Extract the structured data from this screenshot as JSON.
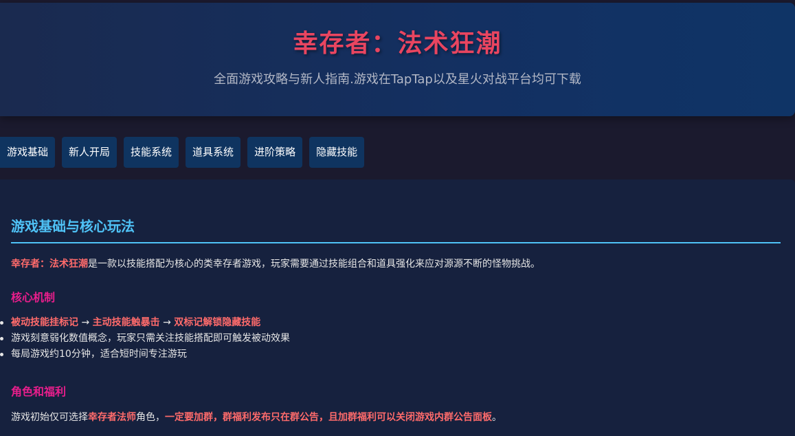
{
  "header": {
    "title": "幸存者：法术狂潮",
    "subtitle": "全面游戏攻略与新人指南.游戏在TapTap以及星火对战平台均可下载"
  },
  "nav": {
    "items": [
      {
        "label": "游戏基础"
      },
      {
        "label": "新人开局"
      },
      {
        "label": "技能系统"
      },
      {
        "label": "道具系统"
      },
      {
        "label": "进阶策略"
      },
      {
        "label": "隐藏技能"
      }
    ]
  },
  "content": {
    "section_title": "游戏基础与核心玩法",
    "intro": {
      "highlight": "幸存者：法术狂潮",
      "text": "是一款以技能搭配为核心的类幸存者游戏，玩家需要通过技能组合和道具强化来应对源源不断的怪物挑战。"
    },
    "core_heading": "核心机制",
    "core_list": {
      "item1": {
        "part1": "被动技能挂标记",
        "arrow1": " → ",
        "part2": "主动技能触暴击",
        "arrow2": " → ",
        "part3": "双标记解锁隐藏技能"
      },
      "item2": "游戏刻意弱化数值概念，玩家只需关注技能搭配即可触发被动效果",
      "item3": "每局游戏约10分钟，适合短时间专注游玩"
    },
    "role_heading": "角色和福利",
    "role_text": {
      "pre": "游戏初始仅可选择",
      "role": "幸存者法师",
      "mid": "角色，",
      "bold": "一定要加群，群福利发布只在群公告，且加群福利可以关闭游戏内群公告面板",
      "end": "。"
    }
  },
  "colors": {
    "accent_red": "#e94560",
    "highlight": "#ff6b6b",
    "section_blue": "#4fc3f7",
    "sub_heading_pink": "#e91e8c",
    "nav_bg": "#0f3460"
  }
}
